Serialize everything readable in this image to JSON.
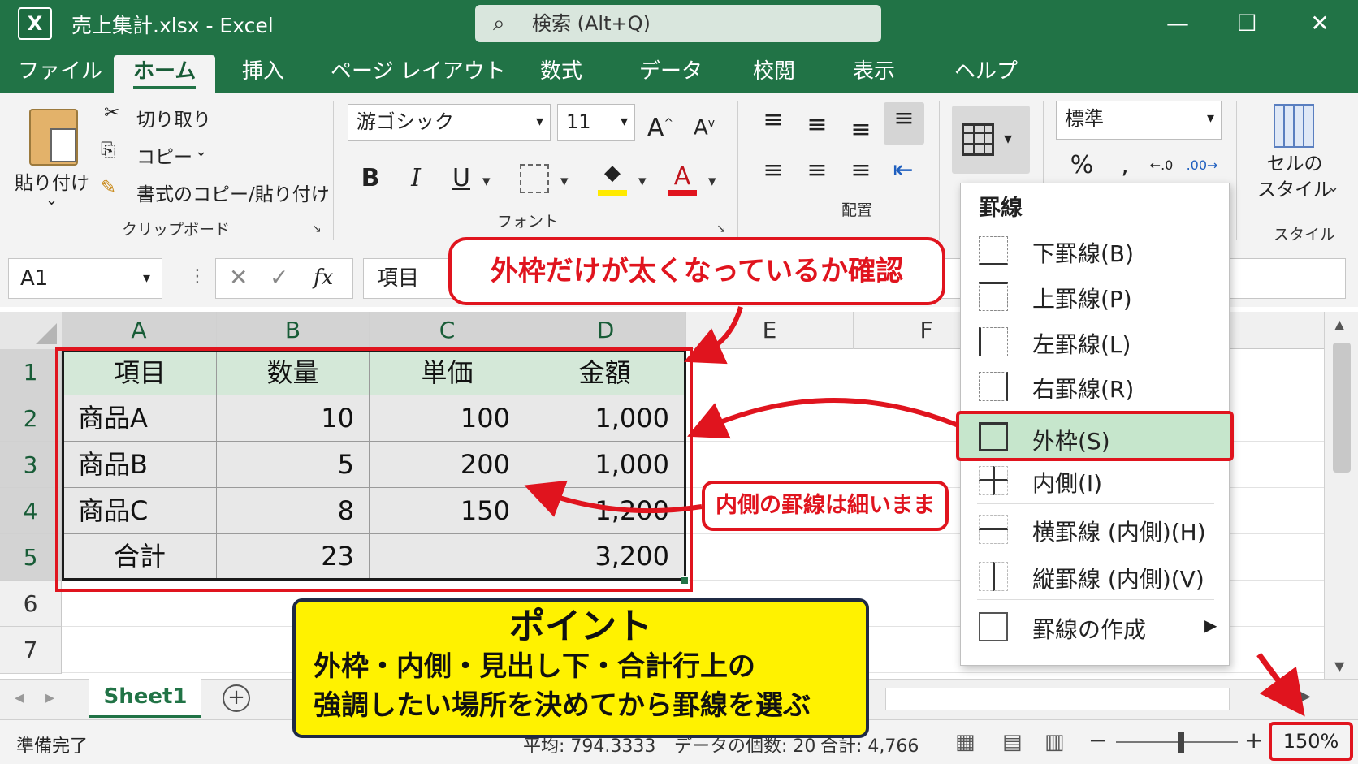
{
  "app": {
    "logo": "X",
    "title": "売上集計.xlsx  -  Excel",
    "search_placeholder": "検索 (Alt+Q)"
  },
  "tabs": [
    "ファイル",
    "ホーム",
    "挿入",
    "ページ レイアウト",
    "数式",
    "データ",
    "校閲",
    "表示",
    "ヘルプ"
  ],
  "ribbon": {
    "clipboard": {
      "paste": "貼り付け",
      "cut": "切り取り",
      "copy": "コピー",
      "format_painter": "書式のコピー/貼り付け",
      "group": "クリップボード"
    },
    "font": {
      "name": "游ゴシック",
      "size": "11",
      "bold": "B",
      "italic": "I",
      "underline": "U",
      "group": "フォント"
    },
    "align": {
      "group": "配置"
    },
    "number": {
      "format": "標準",
      "percent": "%"
    },
    "styles": {
      "cell_styles": "セルの\nスタイル",
      "group": "スタイル"
    }
  },
  "formula_bar": {
    "name_box": "A1",
    "fx": "fx",
    "value": "項目"
  },
  "columns": [
    "A",
    "B",
    "C",
    "D",
    "E",
    "F"
  ],
  "rows": [
    "1",
    "2",
    "3",
    "4",
    "5",
    "6",
    "7"
  ],
  "table": {
    "header": [
      "項目",
      "数量",
      "単価",
      "金額"
    ],
    "body": [
      [
        "商品A",
        "10",
        "100",
        "1,000"
      ],
      [
        "商品B",
        "5",
        "200",
        "1,000"
      ],
      [
        "商品C",
        "8",
        "150",
        "1,200"
      ],
      [
        "合計",
        "23",
        "",
        "3,200"
      ]
    ]
  },
  "border_menu": {
    "title": "罫線",
    "items": [
      "下罫線(B)",
      "上罫線(P)",
      "左罫線(L)",
      "右罫線(R)",
      "外枠(S)",
      "内側(I)",
      "横罫線 (内側)(H)",
      "縦罫線 (内側)(V)",
      "罫線の作成"
    ],
    "highlight_color": "#c6e6cc"
  },
  "callouts": {
    "outer_check": "外枠だけが太くなっているか確認",
    "inner_thin": "内側の罫線は細いまま",
    "point_title": "ポイント",
    "point_line1": "外枠・内側・見出し下・合計行上の",
    "point_line2": "強調したい場所を決めてから罫線を選ぶ"
  },
  "sheet": {
    "tab": "Sheet1",
    "add": "+"
  },
  "status": {
    "ready": "準備完了",
    "average": "平均: 794.3333",
    "count": "データの個数: 20",
    "sum": "合計: 4,766",
    "zoom": "150%"
  },
  "colors": {
    "excel_green": "#217346",
    "accent_red": "#e0141e",
    "point_yellow": "#fff200",
    "header_fill": "#d4e8d8"
  }
}
